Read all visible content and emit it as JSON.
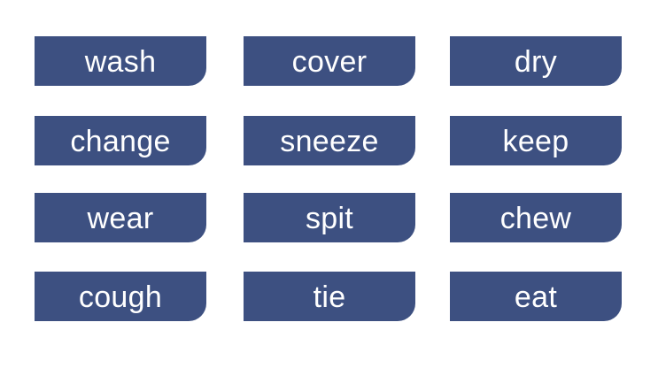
{
  "colors": {
    "card_background": "#3d5081",
    "card_text": "#ffffff",
    "page_background": "#ffffff"
  },
  "cards": [
    {
      "label": "wash"
    },
    {
      "label": "cover"
    },
    {
      "label": "dry"
    },
    {
      "label": "change"
    },
    {
      "label": "sneeze"
    },
    {
      "label": "keep"
    },
    {
      "label": "wear"
    },
    {
      "label": "spit"
    },
    {
      "label": "chew"
    },
    {
      "label": "cough"
    },
    {
      "label": "tie"
    },
    {
      "label": "eat"
    }
  ]
}
